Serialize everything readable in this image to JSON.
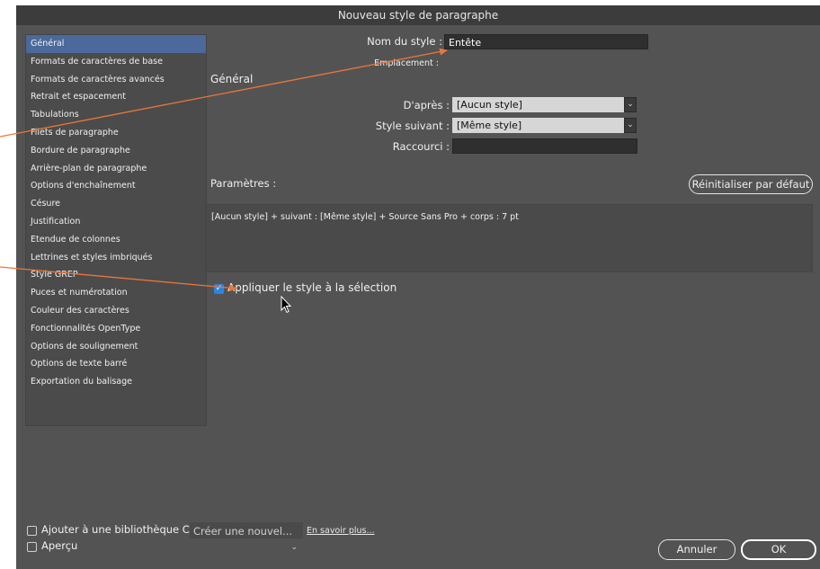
{
  "dialog": {
    "title": "Nouveau style de paragraphe"
  },
  "sidebar": {
    "items": [
      "Général",
      "Formats de caractères de base",
      "Formats de caractères avancés",
      "Retrait et espacement",
      "Tabulations",
      "Filets de paragraphe",
      "Bordure de paragraphe",
      "Arrière-plan de paragraphe",
      "Options d'enchaînement",
      "Césure",
      "Justification",
      "Etendue de colonnes",
      "Lettrines et styles imbriqués",
      "Style GREP",
      "Puces et numérotation",
      "Couleur des caractères",
      "Fonctionnalités OpenType",
      "Options de soulignement",
      "Options de texte barré",
      "Exportation du balisage"
    ],
    "active_index": 0
  },
  "form": {
    "style_name_label": "Nom du style :",
    "style_name_value": "Entête",
    "location_label": "Emplacement :",
    "section_title": "Général",
    "based_on_label": "D'après :",
    "based_on_value": "[Aucun style]",
    "next_style_label": "Style suivant :",
    "next_style_value": "[Même style]",
    "shortcut_label": "Raccourci :",
    "shortcut_value": "",
    "params_label": "Paramètres :",
    "reset_button": "Réinitialiser par défaut",
    "params_text": "[Aucun style] + suivant : [Même style] + Source Sans Pro + corps : 7 pt",
    "apply_label": "Appliquer le style à la sélection",
    "apply_checked": true
  },
  "footer": {
    "cc_label": "Ajouter à une bibliothèque CC:",
    "cc_select": "Créer une nouvel...",
    "learn_more": "En savoir plus...",
    "preview_label": "Aperçu",
    "cancel": "Annuler",
    "ok": "OK"
  },
  "colors": {
    "dialog_bg": "#535353",
    "selection": "#4b6a9b",
    "annotation_arrow": "#e8773a",
    "checkbox": "#2b86e0"
  }
}
